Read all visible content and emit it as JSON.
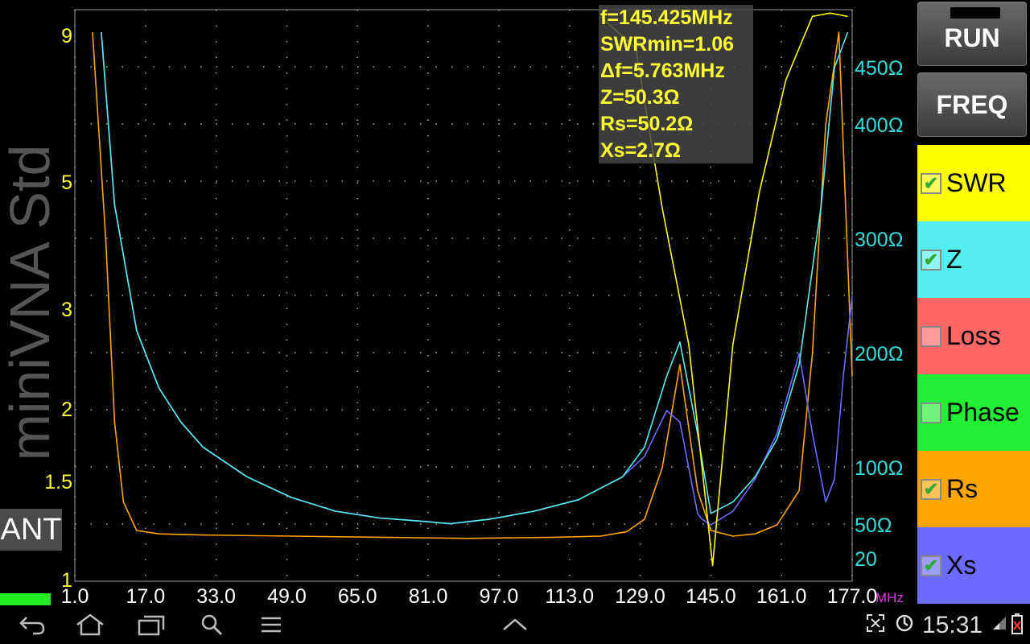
{
  "plot": {
    "left_axis_ticks": [
      "9",
      "5",
      "3",
      "2",
      "1.5",
      "1"
    ],
    "right_axis_ticks": [
      "450Ω",
      "400Ω",
      "300Ω",
      "200Ω",
      "100Ω",
      "50Ω",
      "20"
    ],
    "x_axis_ticks": [
      "1.0",
      "17.0",
      "33.0",
      "49.0",
      "65.0",
      "81.0",
      "97.0",
      "113.0",
      "129.0",
      "145.0",
      "161.0",
      "177.0"
    ],
    "x_unit": "MHz",
    "colors": {
      "left_axis": "#ffff33",
      "right_axis": "#33dddd",
      "x_axis": "#ffffff",
      "unit": "#dd33dd"
    }
  },
  "side_label": "miniVNA Std",
  "ant_label": "ANT",
  "info": {
    "frequency": "f=145.425MHz",
    "swr_min": "SWRmin=1.06",
    "delta_f": "Δf=5.763MHz",
    "z": "Z=50.3Ω",
    "rs": "Rs=50.2Ω",
    "xs": "Xs=2.7Ω"
  },
  "buttons": {
    "run": "RUN",
    "freq": "FREQ"
  },
  "traces": [
    {
      "label": "SWR",
      "checked": true,
      "color": "#ffff00"
    },
    {
      "label": "Z",
      "checked": true,
      "color": "#55eeee"
    },
    {
      "label": "Loss",
      "checked": false,
      "color": "#ff6666"
    },
    {
      "label": "Phase",
      "checked": false,
      "color": "#22ee33"
    },
    {
      "label": "Rs",
      "checked": true,
      "color": "#ffa500"
    },
    {
      "label": "Xs",
      "checked": true,
      "color": "#6b6bff"
    }
  ],
  "chart_data": {
    "type": "line",
    "xlabel": "MHz",
    "xlim": [
      1.0,
      177.0
    ],
    "series": [
      {
        "name": "SWR",
        "color": "#ffff00",
        "x": [
          120,
          128,
          134,
          140,
          145.4,
          150,
          156,
          162,
          168,
          172,
          176
        ],
        "y": [
          9.5,
          8.5,
          4.5,
          2.6,
          1.06,
          2.6,
          4.8,
          7.5,
          9.5,
          9.6,
          9.5
        ]
      },
      {
        "name": "Z",
        "color": "#55eeee",
        "x": [
          7,
          10,
          15,
          20,
          25,
          30,
          40,
          50,
          60,
          70,
          80,
          86,
          95,
          105,
          115,
          125,
          130,
          135,
          138,
          142,
          145,
          150,
          155,
          160,
          165,
          170,
          173,
          176
        ],
        "y": [
          480,
          330,
          220,
          170,
          140,
          118,
          92,
          74,
          62,
          56,
          53,
          51,
          55,
          62,
          72,
          92,
          118,
          180,
          210,
          130,
          60,
          70,
          92,
          125,
          190,
          330,
          450,
          480
        ]
      },
      {
        "name": "Rs",
        "color": "#ffa500",
        "x": [
          5,
          8,
          10,
          12,
          15,
          20,
          30,
          50,
          70,
          90,
          110,
          120,
          126,
          130,
          134,
          138,
          142,
          145,
          150,
          155,
          160,
          165,
          168,
          171,
          174,
          177
        ],
        "y": [
          480,
          300,
          140,
          70,
          45,
          42,
          41,
          40,
          39,
          38,
          39,
          40,
          44,
          55,
          100,
          190,
          80,
          45,
          40,
          42,
          50,
          80,
          200,
          400,
          480,
          180
        ]
      },
      {
        "name": "Xs",
        "color": "#6b6bff",
        "x": [
          7,
          10,
          15,
          20,
          25,
          30,
          40,
          50,
          60,
          70,
          80,
          86,
          95,
          105,
          115,
          125,
          130,
          135,
          138,
          142,
          143,
          145,
          150,
          155,
          160,
          165,
          168,
          171,
          173,
          175,
          177
        ],
        "y": [
          480,
          330,
          220,
          170,
          140,
          118,
          92,
          74,
          62,
          56,
          53,
          51,
          55,
          62,
          72,
          92,
          110,
          150,
          140,
          60,
          55,
          50,
          62,
          90,
          130,
          200,
          130,
          70,
          90,
          180,
          250
        ]
      }
    ]
  }
}
